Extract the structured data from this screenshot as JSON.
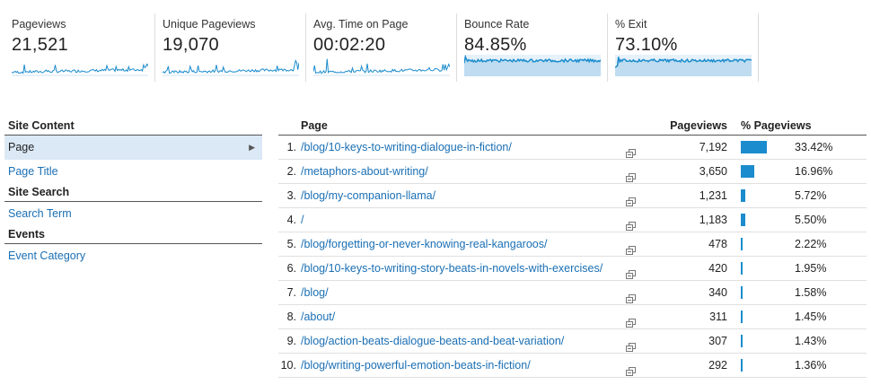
{
  "metrics": [
    {
      "label": "Pageviews",
      "value": "21,521",
      "kind": "line"
    },
    {
      "label": "Unique Pageviews",
      "value": "19,070",
      "kind": "line"
    },
    {
      "label": "Avg. Time on Page",
      "value": "00:02:20",
      "kind": "line"
    },
    {
      "label": "Bounce Rate",
      "value": "84.85%",
      "kind": "area"
    },
    {
      "label": "% Exit",
      "value": "73.10%",
      "kind": "area"
    }
  ],
  "nav": {
    "site_content_header": "Site Content",
    "page_item": "Page",
    "page_title_item": "Page Title",
    "site_search_header": "Site Search",
    "search_term_item": "Search Term",
    "events_header": "Events",
    "event_category_item": "Event Category"
  },
  "table": {
    "col_page": "Page",
    "col_pageviews": "Pageviews",
    "col_pct": "% Pageviews",
    "rows": [
      {
        "num": "1.",
        "page": "/blog/10-keys-to-writing-dialogue-in-fiction/",
        "pageviews": "7,192",
        "pct": "33.42%",
        "share": 0.3342
      },
      {
        "num": "2.",
        "page": "/metaphors-about-writing/",
        "pageviews": "3,650",
        "pct": "16.96%",
        "share": 0.1696
      },
      {
        "num": "3.",
        "page": "/blog/my-companion-llama/",
        "pageviews": "1,231",
        "pct": "5.72%",
        "share": 0.0572
      },
      {
        "num": "4.",
        "page": "/",
        "pageviews": "1,183",
        "pct": "5.50%",
        "share": 0.055
      },
      {
        "num": "5.",
        "page": "/blog/forgetting-or-never-knowing-real-kangaroos/",
        "pageviews": "478",
        "pct": "2.22%",
        "share": 0.0222
      },
      {
        "num": "6.",
        "page": "/blog/10-keys-to-writing-story-beats-in-novels-with-exercises/",
        "pageviews": "420",
        "pct": "1.95%",
        "share": 0.0195
      },
      {
        "num": "7.",
        "page": "/blog/",
        "pageviews": "340",
        "pct": "1.58%",
        "share": 0.0158
      },
      {
        "num": "8.",
        "page": "/about/",
        "pageviews": "311",
        "pct": "1.45%",
        "share": 0.0145
      },
      {
        "num": "9.",
        "page": "/blog/action-beats-dialogue-beats-and-beat-variation/",
        "pageviews": "307",
        "pct": "1.43%",
        "share": 0.0143
      },
      {
        "num": "10.",
        "page": "/blog/writing-powerful-emotion-beats-in-fiction/",
        "pageviews": "292",
        "pct": "1.36%",
        "share": 0.0136
      }
    ]
  },
  "colors": {
    "accent": "#1b8ccd",
    "link": "#1a6fb4",
    "selected_bg": "#dbe9f6"
  },
  "icons": {
    "row_link": "external-link-icon",
    "nav_arrow": "caret-right-icon"
  }
}
